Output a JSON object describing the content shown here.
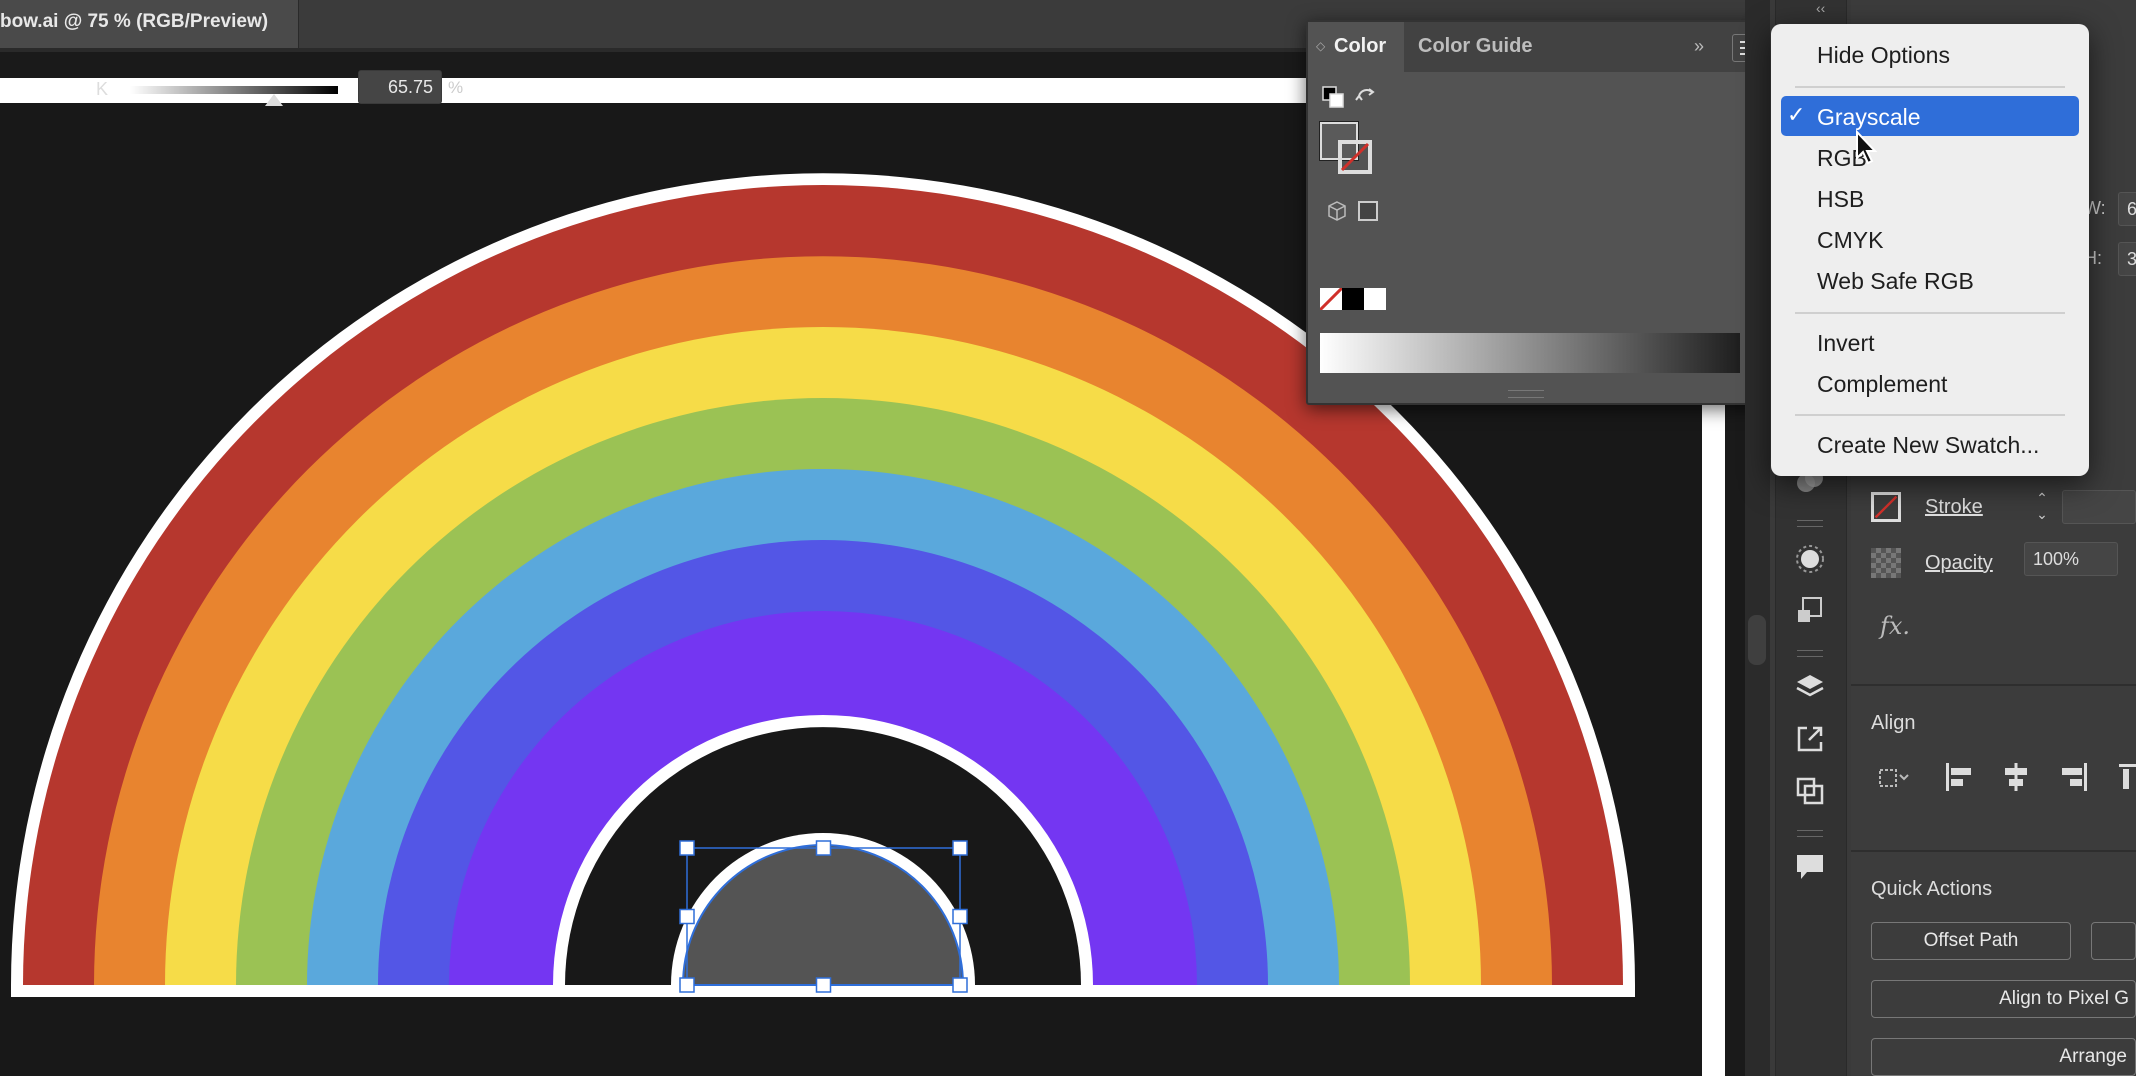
{
  "document_tab": {
    "title": "bow.ai @ 75 % (RGB/Preview)"
  },
  "artwork": {
    "band_colors": [
      "#b6372e",
      "#e8842f",
      "#f6dc48",
      "#9bc254",
      "#5aa8dc",
      "#5356e6",
      "#7436f2"
    ],
    "outline_color": "#ffffff",
    "selected_shape_fill": "#545454",
    "selection_color": "#2f6ed9"
  },
  "color_panel": {
    "tabs": [
      "Color",
      "Color Guide"
    ],
    "collapse_glyph": "»",
    "channel_label": "K",
    "channel_value": "65.75",
    "unit": "%",
    "k_level_percent": 65.75
  },
  "menu": {
    "items": [
      "Hide Options",
      "Grayscale",
      "RGB",
      "HSB",
      "CMYK",
      "Web Safe RGB",
      "Invert",
      "Complement",
      "Create New Swatch..."
    ],
    "checked_index": 1,
    "check_glyph": "✓"
  },
  "properties": {
    "dock_top_glyph": "‹‹",
    "edge_w": "W:",
    "edge_h": "H:",
    "edge_w_value": "6",
    "edge_h_value": "3",
    "stroke_label": "Stroke",
    "opacity_label": "Opacity",
    "opacity_value": "100%",
    "fx_label": "fx.",
    "align_title": "Align",
    "quick_actions_title": "Quick Actions",
    "offset_path_label": "Offset Path",
    "align_pixel_label": "Align to Pixel G",
    "arrange_label": "Arrange"
  }
}
